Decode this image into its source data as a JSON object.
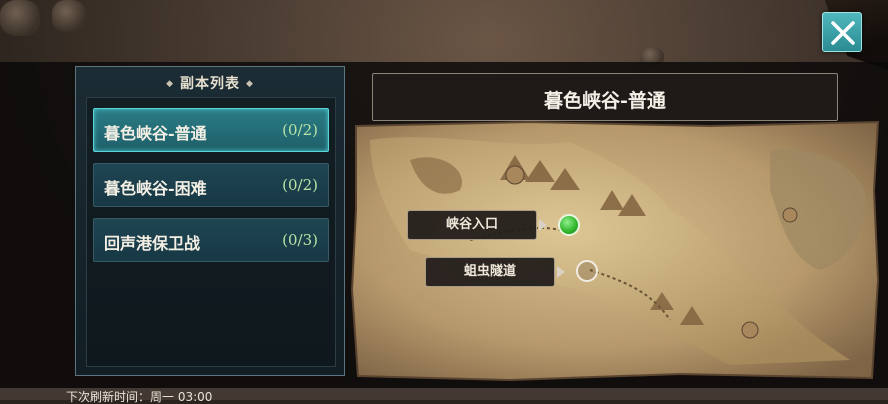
{
  "close_button": {
    "icon": "close-icon",
    "color": "#3aa6ad"
  },
  "dungeon_list": {
    "header": "副本列表",
    "items": [
      {
        "name": "暮色峡谷-普通",
        "count": "(0/2)",
        "selected": true
      },
      {
        "name": "暮色峡谷-困难",
        "count": "(0/2)",
        "selected": false
      },
      {
        "name": "回声港保卫战",
        "count": "(0/3)",
        "selected": false
      }
    ]
  },
  "map": {
    "title": "暮色峡谷-普通",
    "locations": [
      {
        "label": "峡谷入口",
        "marker": "green-marker",
        "status": "current"
      },
      {
        "label": "蛆虫隧道",
        "marker": "empty-marker",
        "status": "locked"
      }
    ]
  },
  "footer": {
    "refresh_text": "下次刷新时间：周一 03:00"
  },
  "colors": {
    "accent": "#2b7d86",
    "selected_border": "#5ad3d9",
    "count": "#b9e3a6",
    "map_parchment": "#c9ad7d"
  }
}
